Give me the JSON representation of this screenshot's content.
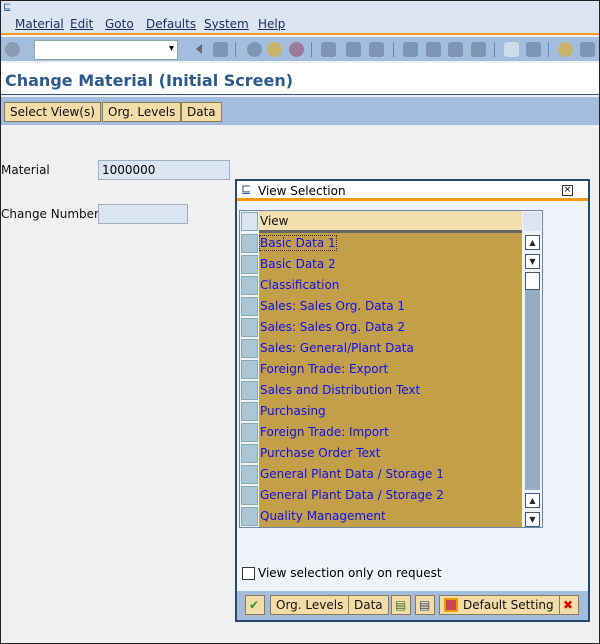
{
  "menu": [
    "Material",
    "Edit",
    "Goto",
    "Defaults",
    "System",
    "Help"
  ],
  "command_field": {
    "value": ""
  },
  "page_title": "Change Material (Initial Screen)",
  "app_toolbar": {
    "select_views": "Select View(s)",
    "org_levels": "Org. Levels",
    "data": "Data"
  },
  "form": {
    "material_label": "Material",
    "material_value": "1000000",
    "change_number_label": "Change Number",
    "change_number_value": ""
  },
  "dialog": {
    "title": "View Selection",
    "column_header": "View",
    "rows": [
      "Basic Data 1",
      "Basic Data 2",
      "Classification",
      "Sales: Sales Org. Data 1",
      "Sales: Sales Org. Data 2",
      "Sales: General/Plant Data",
      "Foreign Trade: Export",
      "Sales and Distribution Text",
      "Purchasing",
      "Foreign Trade: Import",
      "Purchase Order Text",
      "General Plant Data / Storage 1",
      "General Plant Data / Storage 2",
      "Quality Management"
    ],
    "checkbox_label": "View selection only on request",
    "checkbox_checked": false,
    "buttons": {
      "org_levels": "Org. Levels",
      "data": "Data",
      "default_setting": "Default Setting"
    }
  }
}
